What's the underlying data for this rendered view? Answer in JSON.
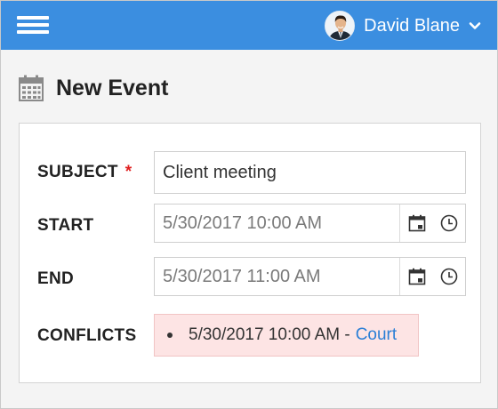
{
  "header": {
    "user_name": "David Blane"
  },
  "page": {
    "title": "New Event"
  },
  "form": {
    "subject_label": "SUBJECT",
    "required_mark": "*",
    "subject_value": "Client meeting",
    "start_label": "START",
    "start_value": "5/30/2017 10:00 AM",
    "end_label": "END",
    "end_value": "5/30/2017 11:00 AM",
    "conflicts_label": "CONFLICTS",
    "conflict": {
      "time": "5/30/2017 10:00 AM -",
      "link": "Court"
    }
  },
  "colors": {
    "header_bg": "#3b8ee0",
    "conflict_bg": "#fde4e4",
    "link": "#2b7fd6",
    "required": "#e02020"
  },
  "icons": [
    "menu-icon",
    "chevron-down-icon",
    "calendar-icon",
    "calendar-date-icon",
    "clock-icon"
  ]
}
